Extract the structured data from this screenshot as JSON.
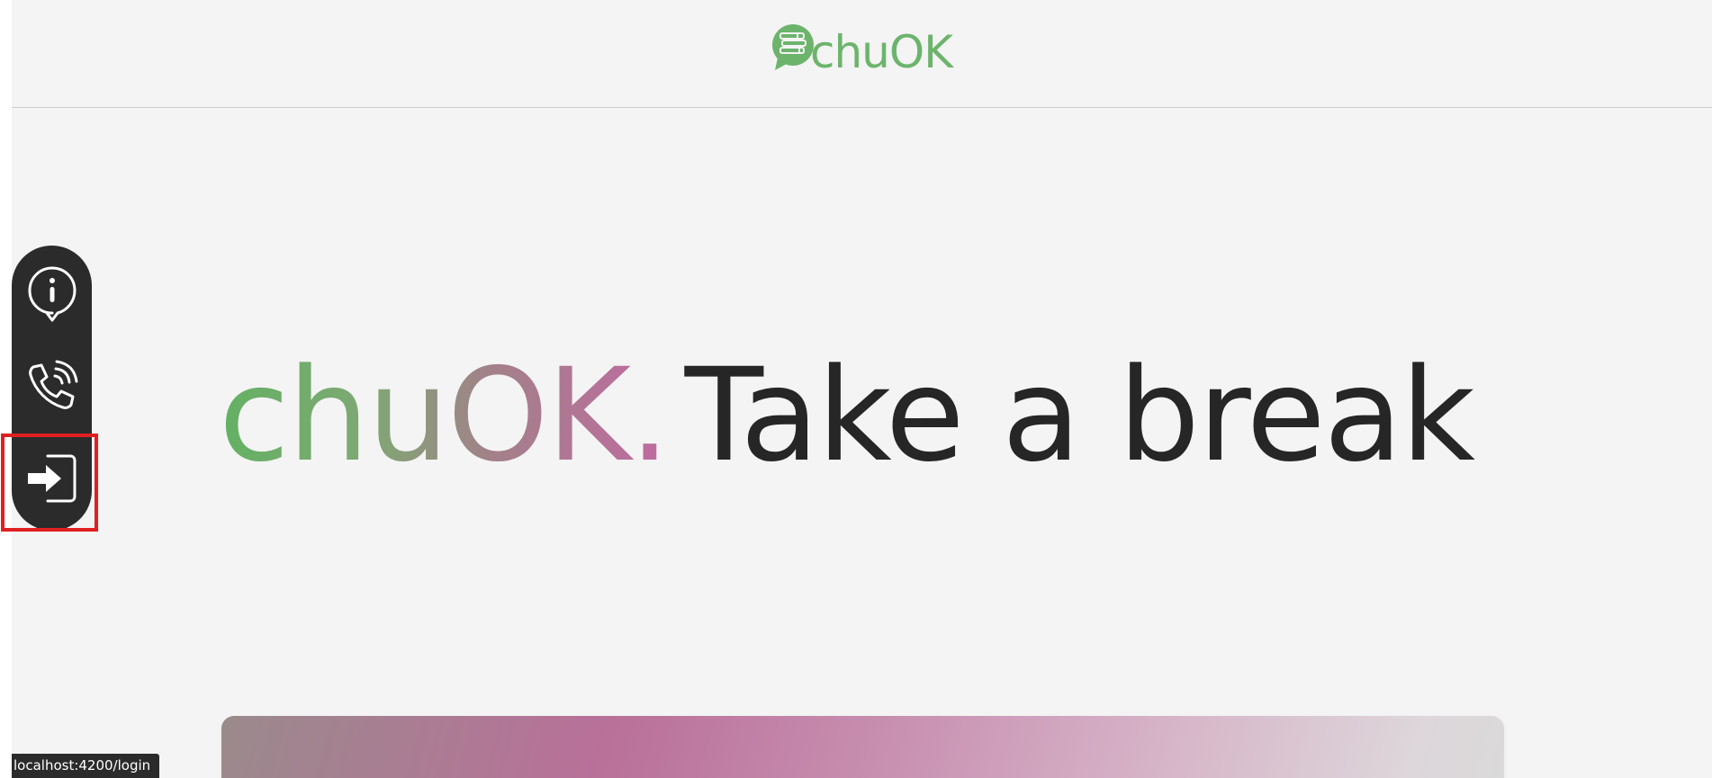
{
  "header": {
    "logo_text": "chuOK",
    "logo_icon": "chat-bubble-books-icon"
  },
  "hero": {
    "brand_text": "chuOK.",
    "tagline": "Take a break"
  },
  "side_nav": {
    "items": [
      {
        "icon": "info-bubble-icon"
      },
      {
        "icon": "phone-call-icon"
      },
      {
        "icon": "login-icon"
      }
    ]
  },
  "status_bar": {
    "url": "localhost:4200/login"
  },
  "colors": {
    "brand_green": "#6cb46c",
    "brand_pink": "#c06aa0",
    "dark": "#2b2b2b",
    "background": "#f4f4f4",
    "highlight": "#e02020"
  }
}
